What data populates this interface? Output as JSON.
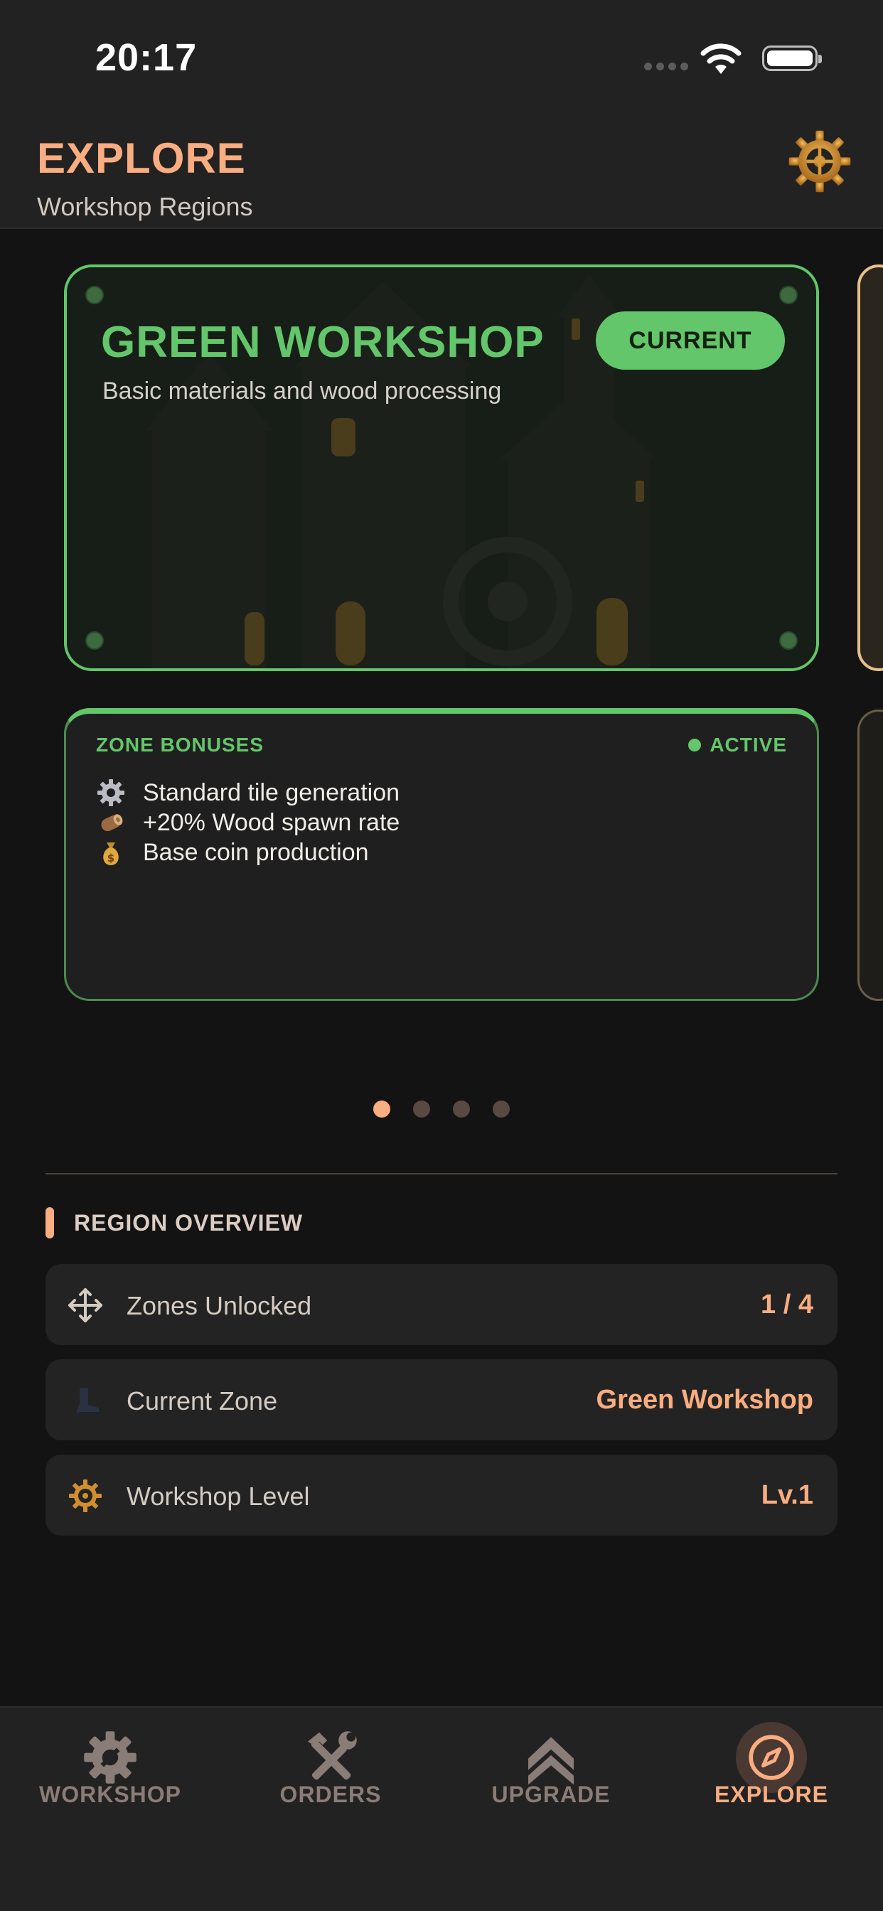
{
  "status_bar": {
    "time": "20:17"
  },
  "header": {
    "title": "EXPLORE",
    "subtitle": "Workshop Regions",
    "settings_icon": "gear-icon"
  },
  "zone_card": {
    "title": "GREEN WORKSHOP",
    "description": "Basic materials and wood processing",
    "badge": "CURRENT",
    "accent": "#63c66a"
  },
  "bonuses": {
    "label": "ZONE BONUSES",
    "status": "ACTIVE",
    "items": [
      {
        "icon": "gear-icon",
        "text": "Standard tile generation"
      },
      {
        "icon": "wood-log-icon",
        "text": "+20% Wood spawn rate"
      },
      {
        "icon": "money-bag-icon",
        "text": "Base coin production"
      }
    ]
  },
  "pagination": {
    "count": 4,
    "active_index": 0
  },
  "overview": {
    "title": "REGION OVERVIEW",
    "rows": [
      {
        "icon": "move-arrows-icon",
        "label": "Zones Unlocked",
        "value": "1 / 4"
      },
      {
        "icon": "boot-icon",
        "label": "Current Zone",
        "value": "Green Workshop"
      },
      {
        "icon": "gear-icon",
        "label": "Workshop Level",
        "value": "Lv.1"
      }
    ]
  },
  "tabs": [
    {
      "icon": "gear-icon",
      "label": "WORKSHOP"
    },
    {
      "icon": "tools-icon",
      "label": "ORDERS"
    },
    {
      "icon": "chevron-up-icon",
      "label": "UPGRADE"
    },
    {
      "icon": "compass-icon",
      "label": "EXPLORE",
      "active": true
    }
  ],
  "colors": {
    "accent": "#f9ad80",
    "zone_green": "#63c66a",
    "background": "#131313"
  }
}
